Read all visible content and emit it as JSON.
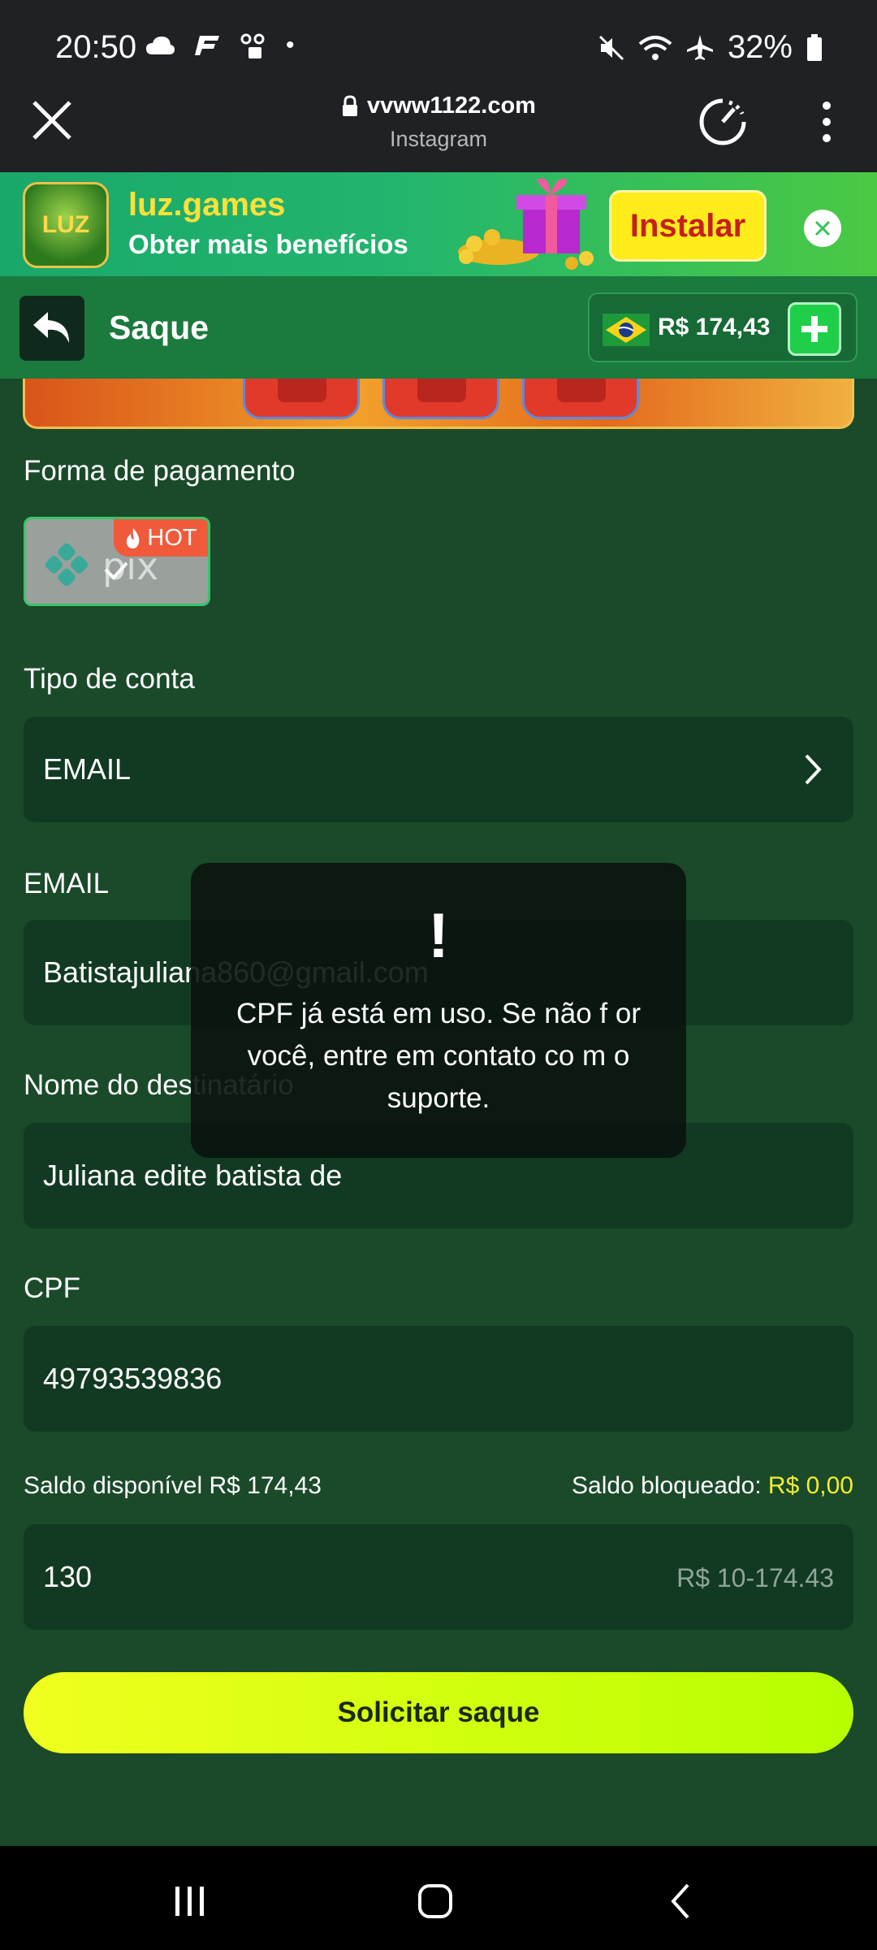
{
  "status_bar": {
    "time": "20:50",
    "battery": "32%"
  },
  "browser": {
    "url": "vvww1122.com",
    "source": "Instagram"
  },
  "ad": {
    "title": "luz.games",
    "subtitle": "Obter mais benefícios",
    "install_label": "Instalar",
    "icon_text": "LUZ"
  },
  "header": {
    "title": "Saque",
    "balance": "R$ 174,43"
  },
  "form": {
    "payment_label": "Forma de pagamento",
    "hot_badge": "HOT",
    "account_type_label": "Tipo de conta",
    "account_type_value": "EMAIL",
    "email_label": "EMAIL",
    "email_value": "Batistajuliana860@gmail.com",
    "recipient_label": "Nome do destinatário",
    "recipient_value": "Juliana edite batista de",
    "cpf_label": "CPF",
    "cpf_value": "49793539836",
    "saldo_disponivel_label": "Saldo disponível R$ ",
    "saldo_disponivel_value": "174,43",
    "saldo_bloqueado_label": "Saldo bloqueado: ",
    "saldo_bloqueado_value": "R$ 0,00",
    "amount_value": "130",
    "amount_range": "R$ 10-174.43",
    "submit_label": "Solicitar saque"
  },
  "toast": {
    "mark": "!",
    "message": "CPF já está em uso. Se não f or você, entre em contato co m o suporte."
  },
  "colors": {
    "background": "#1a4a2a",
    "field": "#123a22",
    "accent_yellow": "#f2ec2e",
    "header_green": "#1b7a3e"
  }
}
